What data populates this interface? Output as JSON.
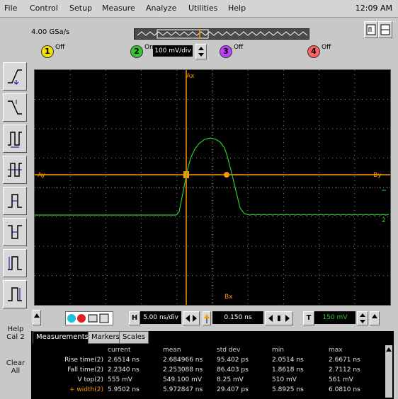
{
  "menu": [
    "File",
    "Control",
    "Setup",
    "Measure",
    "Analyze",
    "Utilities",
    "Help"
  ],
  "clock": "12:09 AM",
  "sample_rate": "4.00 GSa/s",
  "channels": [
    {
      "num": "1",
      "line1": "Off",
      "line2": "",
      "color": "#f0e000"
    },
    {
      "num": "2",
      "line1": "On",
      "line2": "",
      "scale": "100 mV/div",
      "color": "#32c832"
    },
    {
      "num": "3",
      "line1": "Off",
      "line2": "",
      "color": "#c040ff"
    },
    {
      "num": "4",
      "line1": "Off",
      "line2": "",
      "color": "#ff6060"
    }
  ],
  "screen": {
    "top_marker": "Ax",
    "bottom_marker": "Bx",
    "left_marker": "Ay",
    "right_marker": "By",
    "ch_marker": "2"
  },
  "controls": {
    "horizontal_label": "H",
    "time_div": "5.00 ns/div",
    "delay": "0.150 ns",
    "trigger_label": "T",
    "trigger_level": "150 mV"
  },
  "side_buttons": {
    "help": "Help Cal 2",
    "clear": "Clear All"
  },
  "measure_tabs": [
    "Measurements",
    "Markers",
    "Scales"
  ],
  "measure_headers": [
    "",
    "current",
    "mean",
    "std dev",
    "min",
    "max"
  ],
  "measure_rows": [
    {
      "name": "Rise time(2)",
      "current": "2.6514 ns",
      "mean": "2.684966 ns",
      "std": "95.402 ps",
      "min": "2.0514 ns",
      "max": "2.6671 ns"
    },
    {
      "name": "Fall time(2)",
      "current": "2.2340 ns",
      "mean": "2.253088 ns",
      "std": "86.403 ps",
      "min": "1.8618 ns",
      "max": "2.7112 ns"
    },
    {
      "name": "V top(2)",
      "current": "555 mV",
      "mean": "549.100 mV",
      "std": "8.25 mV",
      "min": "510 mV",
      "max": "561 mV"
    },
    {
      "name": "+ width(2)",
      "current": "5.9502 ns",
      "mean": "5.972847 ns",
      "std": "29.407 ps",
      "min": "5.8925 ns",
      "max": "6.0810 ns"
    }
  ],
  "colors": {
    "trace": "#32c832",
    "marker": "#ff9600",
    "grid": "#8a8a8a"
  }
}
